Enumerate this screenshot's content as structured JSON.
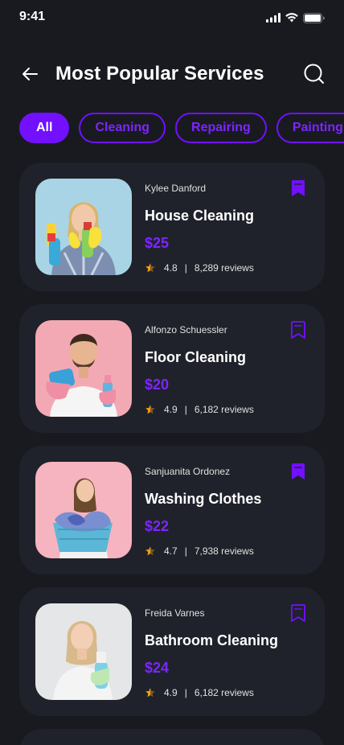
{
  "status": {
    "time": "9:41"
  },
  "header": {
    "title": "Most Popular Services"
  },
  "filters": [
    "All",
    "Cleaning",
    "Repairing",
    "Painting"
  ],
  "active_filter": "All",
  "colors": {
    "accent": "#7210FF",
    "background": "#181A20",
    "card": "#1F222A",
    "star": "#FFA000"
  },
  "services": [
    {
      "provider": "Kylee Danford",
      "title": "House Cleaning",
      "price": "$25",
      "rating": "4.8",
      "reviews": "8,289 reviews",
      "bookmarked": true,
      "image": "woman-with-cleaning-spray"
    },
    {
      "provider": "Alfonzo Schuessler",
      "title": "Floor Cleaning",
      "price": "$20",
      "rating": "4.9",
      "reviews": "6,182 reviews",
      "bookmarked": false,
      "image": "man-with-sponge-and-spray"
    },
    {
      "provider": "Sanjuanita Ordonez",
      "title": "Washing Clothes",
      "price": "$22",
      "rating": "4.7",
      "reviews": "7,938 reviews",
      "bookmarked": true,
      "image": "woman-with-laundry-basket"
    },
    {
      "provider": "Freida Varnes",
      "title": "Bathroom Cleaning",
      "price": "$24",
      "rating": "4.9",
      "reviews": "6,182 reviews",
      "bookmarked": false,
      "image": "woman-with-spray-bottle"
    }
  ],
  "rating_separator": "|"
}
